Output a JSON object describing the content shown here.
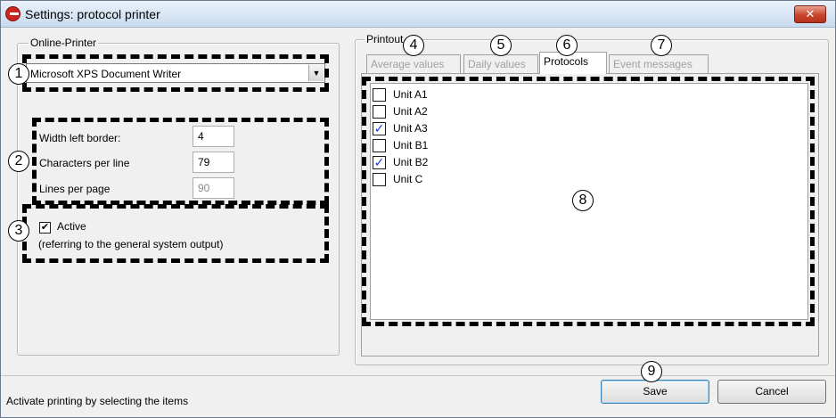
{
  "window": {
    "title": "Settings: protocol printer",
    "close_glyph": "✕",
    "app_icon": "app-logo-icon"
  },
  "online_printer": {
    "legend": "Online-Printer",
    "printer_selected": "Microsoft XPS Document Writer",
    "dropdown_glyph": "▼",
    "fields": [
      {
        "label": "Width left border:",
        "value": "4",
        "enabled": true
      },
      {
        "label": "Characters per line",
        "value": "79",
        "enabled": true
      },
      {
        "label": "Lines per page",
        "value": "90",
        "enabled": false
      }
    ],
    "active": {
      "label": "Active",
      "checked": true,
      "glyph": "✔",
      "note": "(referring to the general system output)"
    }
  },
  "printout": {
    "legend": "Printout",
    "tabs": [
      {
        "label": "Average values",
        "active": false
      },
      {
        "label": "Daily values",
        "active": false
      },
      {
        "label": "Protocols",
        "active": true
      },
      {
        "label": "Event messages",
        "active": false
      }
    ],
    "check_glyph": "✓",
    "units": [
      {
        "label": "Unit A1",
        "checked": false
      },
      {
        "label": "Unit A2",
        "checked": false
      },
      {
        "label": "Unit A3",
        "checked": true
      },
      {
        "label": "Unit B1",
        "checked": false
      },
      {
        "label": "Unit B2",
        "checked": true
      },
      {
        "label": "Unit C",
        "checked": false
      }
    ]
  },
  "buttons": {
    "save": "Save",
    "cancel": "Cancel"
  },
  "status": {
    "text": "Activate printing by selecting the items"
  },
  "annotations": [
    "1",
    "2",
    "3",
    "4",
    "5",
    "6",
    "7",
    "8",
    "9"
  ],
  "colors": {
    "check_blue": "#1e3ad6",
    "close_red": "#c9452d",
    "window_bg": "#f0f0f0"
  }
}
